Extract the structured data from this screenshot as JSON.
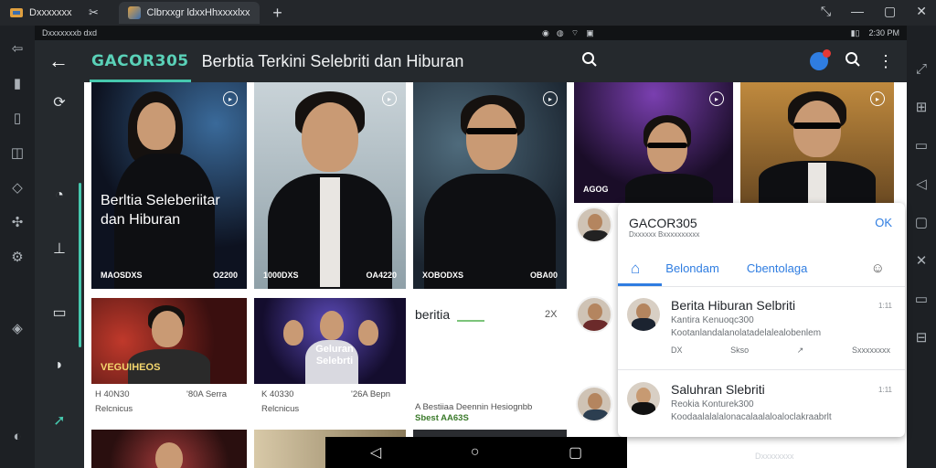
{
  "browser": {
    "app_label": "Dxxxxxxx",
    "tab_title": "Clbrxxgr ldxxHhxxxxlxx",
    "new_tab": "+",
    "window_controls": [
      "⤡",
      "—",
      "▢",
      "✕"
    ]
  },
  "status_bar": {
    "left": "Dxxxxxxxb dxd",
    "time": "2:30 PM"
  },
  "appbar": {
    "brand": "GACOR305",
    "title": "Berbtia Terkini Selebriti dan Hiburan"
  },
  "cards": [
    {
      "overlay": "Berltia Seleberiitar dan Hiburan",
      "foot_left": "MAOSDXS",
      "foot_right": "O2200"
    },
    {
      "overlay": "",
      "foot_left": "1000DXS",
      "foot_right": "OA4220"
    },
    {
      "overlay": "",
      "foot_left": "XOBODXS",
      "foot_right": "OBA00"
    },
    {
      "overlay": "",
      "label": "AGOG",
      "foot_left": "",
      "foot_right": ""
    },
    {
      "overlay": "",
      "foot_left": "",
      "foot_right": ""
    }
  ],
  "row2": [
    {
      "badge": "VEGUIHEOS",
      "cap_left": "H 40N30",
      "cap_left2": "Relcnicus",
      "cap_right": "'80A Serra"
    },
    {
      "badge": "Geluran Selebrti",
      "cap_left": "K 40330",
      "cap_left2": "Relcnicus",
      "cap_right": "'26A Bepn"
    },
    {
      "title": "beritia",
      "title_right": "2X",
      "line1": "A Bestiiaa Deennin Hesiognbb",
      "line2": "Sbest AA63S"
    }
  ],
  "panel": {
    "title": "GACOR305",
    "subtitle": "Dxxxxxx Bxxxxxxxxxx",
    "ok": "OK",
    "tabs": [
      "Belondam",
      "Cbentolaga"
    ],
    "items": [
      {
        "title": "Berita Hiburan Selbriti",
        "line2": "Kantira Kenuoqc300",
        "line3": "Kootanlandalanolatadelalealobenlem",
        "time": "1:11",
        "foot_left": "DX",
        "foot_mid": "Skso",
        "foot_right": "Sxxxxxxxx"
      },
      {
        "title": "Saluhran Slebriti",
        "line2": "Reokia Konturek300",
        "line3": "Koodaalalalalonacalaalaloaloclakraabrlt",
        "time": "1:11",
        "foot_left": "",
        "foot_mid": "",
        "foot_right": ""
      }
    ]
  },
  "bottom_right": "Dxxxxxxxx",
  "colors": {
    "accent": "#46c8ae",
    "link_blue": "#2f7de1",
    "appbar": "#25292d"
  }
}
